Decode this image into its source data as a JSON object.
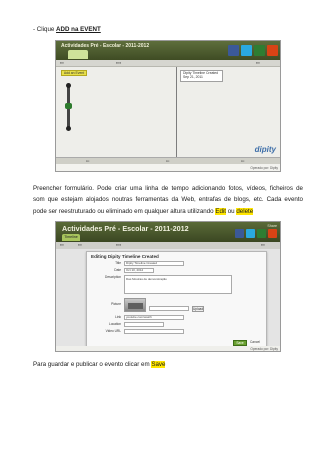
{
  "intro": {
    "prefix": "- Clique ",
    "link": "ADD na EVENT"
  },
  "shot1": {
    "app_title": "Actividades Pré - Escolar - 2011-2012",
    "add_button": "Add an Event",
    "tooltip_title": "Dipity Timeline Created",
    "tooltip_date": "Sep 21, 2011",
    "brand": "dipity",
    "footer": "Operado por: Dipity"
  },
  "paragraph": {
    "line1": "Preencher formulário. Pode criar uma linha de tempo adicionando fotos, vídeos, ficheiros de",
    "line2": "som que estejam alojados noutras ferramentas da Web, entrafas de blogs, etc. Cada evento",
    "line3_prefix": "pode ser reestruturado ou eliminado em qualquer altura utilizando ",
    "edit_word": "Edit",
    "ou": " ou ",
    "delete_word": "delete"
  },
  "shot2": {
    "app_title": "Actividades Pré - Escolar - 2011-2012",
    "tab": "Timeline",
    "share": "Share",
    "dialog_title": "Editing Dipity Timeline Created",
    "form": {
      "title_label": "Title",
      "title_value": "Dipity Timeline Created",
      "date_label": "Date",
      "date_value": "Oct 10, 2012",
      "description_label": "Description",
      "description_value": "Das Mostras de demonstração",
      "picture_label": "Picture",
      "upload_button": "Upload",
      "link_label": "Link",
      "link_value": "youtube.com/watch",
      "location_label": "Location",
      "video_label": "Video URL",
      "save_button": "Save",
      "cancel_link": "Cancel"
    },
    "footer": "Operado por: Dipity"
  },
  "closing": {
    "prefix": "Para guardar e publicar  o evento  clicar em ",
    "save_word": "Save"
  }
}
